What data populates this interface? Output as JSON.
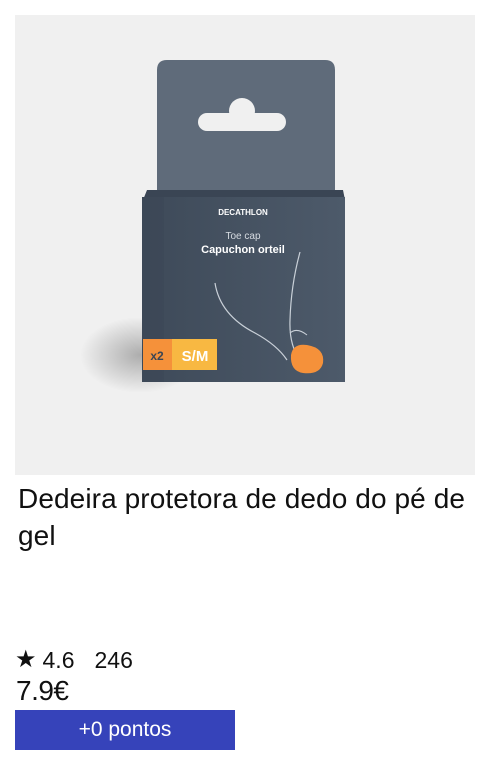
{
  "product": {
    "image": {
      "brand_text": "DECATHLON",
      "label_en": "Toe cap",
      "label_fr": "Capuchon orteil",
      "quantity": "x2",
      "size": "S/M",
      "colors": {
        "background": "#f0f0f0",
        "box": "#4a5666",
        "accent": "#f5913a",
        "size_badge": "#f8b842"
      }
    },
    "title": "Dedeira protetora de dedo do pé de gel",
    "rating": {
      "star_icon": "star-icon",
      "value": "4.6",
      "count": "246"
    },
    "price": "7.9€",
    "points_button_label": "+0 pontos",
    "accent_color": "#3643ba"
  }
}
